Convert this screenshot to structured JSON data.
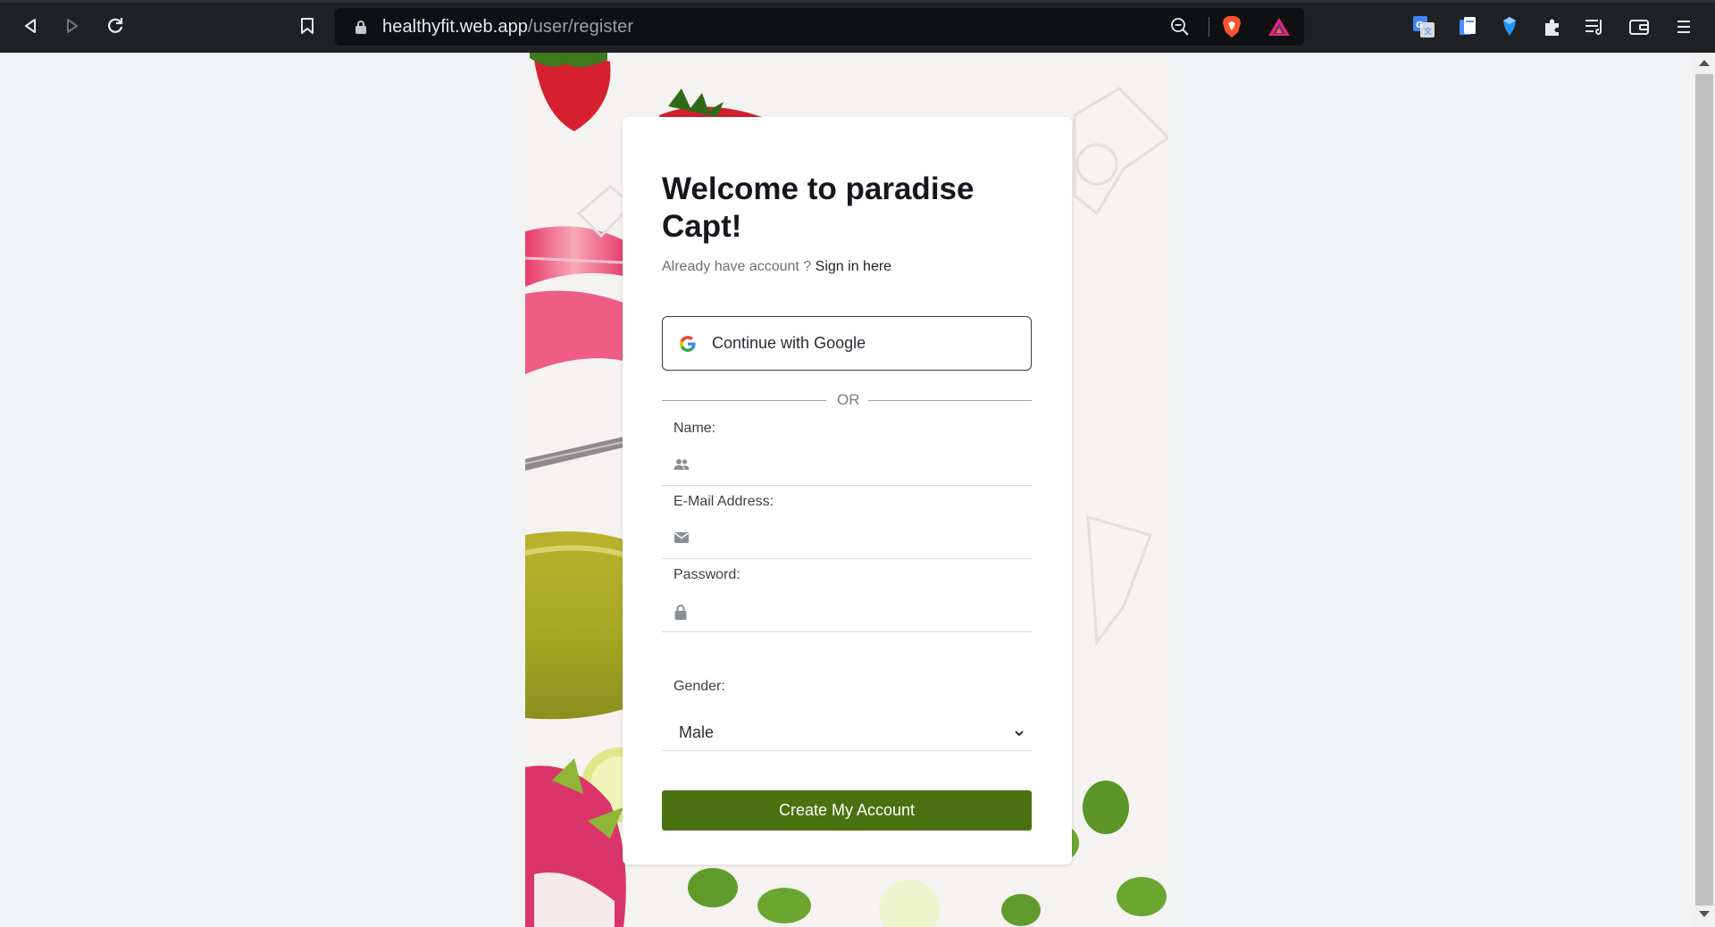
{
  "browser": {
    "url_host": "healthyfit.web.app",
    "url_path": "/user/register",
    "icons": [
      "back-icon",
      "forward-icon",
      "reload-icon",
      "bookmark-icon",
      "lock-icon",
      "zoom-icon",
      "brave-shields-icon",
      "brave-rewards-icon",
      "google-translate-icon",
      "files-extension-icon",
      "gem-extension-icon",
      "extensions-puzzle-icon",
      "playlist-icon",
      "wallet-icon",
      "menu-icon"
    ]
  },
  "register": {
    "title": "Welcome to paradise Capt!",
    "already_text": "Already have account ?",
    "signin_link": "Sign in here",
    "google_label": "Continue with Google",
    "or_text": "OR",
    "name_label": "Name:",
    "email_label": "E-Mail Address:",
    "password_label": "Password:",
    "gender_label": "Gender:",
    "gender_value": "Male",
    "submit_label": "Create My Account"
  },
  "colors": {
    "accent": "#4b7210",
    "chrome_bg": "#202124"
  }
}
